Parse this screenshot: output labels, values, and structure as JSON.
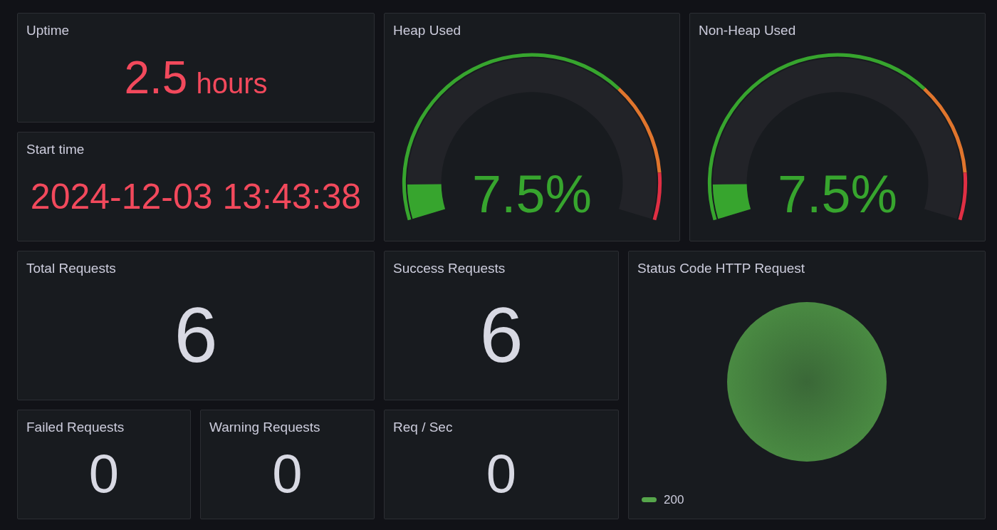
{
  "panels": [
    {
      "kind": "stat",
      "title": "Uptime",
      "value": "2.5",
      "unit": "hours",
      "color": "#f2495c"
    },
    {
      "kind": "stat",
      "title": "Start time",
      "value": "2024-12-03 13:43:38",
      "color": "#f2495c"
    },
    {
      "kind": "gauge",
      "title": "Heap Used",
      "value": "7.5%",
      "level": 0.075
    },
    {
      "kind": "gauge",
      "title": "Non-Heap Used",
      "value": "7.5%",
      "level": 0.075
    },
    {
      "kind": "stat",
      "title": "Total Requests",
      "value": "6",
      "color": "#d8d9e3"
    },
    {
      "kind": "stat",
      "title": "Success Requests",
      "value": "6",
      "color": "#d8d9e3"
    },
    {
      "kind": "pie",
      "title": "Status Code HTTP Request",
      "legend": [
        {
          "label": "200",
          "color": "#56a64b"
        }
      ]
    },
    {
      "kind": "stat",
      "title": "Failed Requests",
      "value": "0",
      "color": "#d8d9e3"
    },
    {
      "kind": "stat",
      "title": "Warning Requests",
      "value": "0",
      "color": "#d8d9e3"
    },
    {
      "kind": "stat",
      "title": "Req / Sec",
      "value": "0",
      "color": "#d8d9e3"
    }
  ]
}
